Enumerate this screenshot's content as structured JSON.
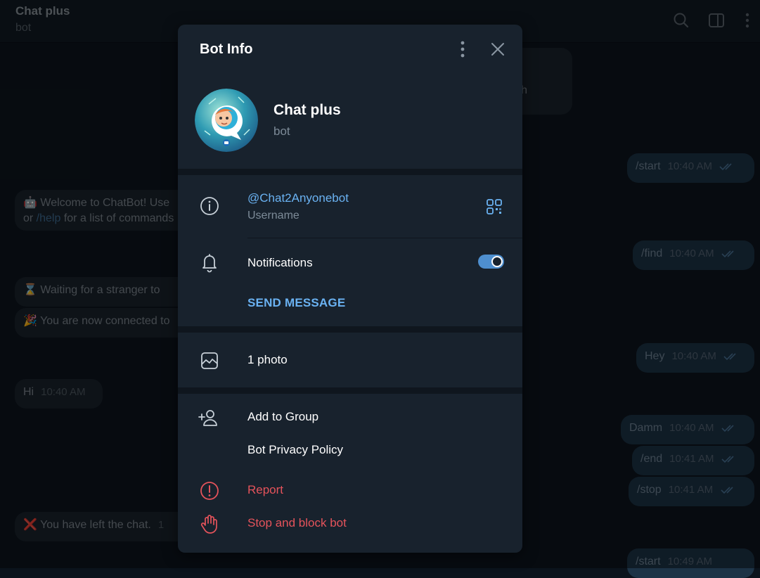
{
  "chat": {
    "title": "Chat plus",
    "subtitle": "bot",
    "messages": [
      {
        "text": "/start",
        "time": "10:40 AM"
      },
      {
        "text_prefix": "Welcome to ChatBot! Use",
        "text_line2_pre": "or ",
        "text_line2_link": "/help",
        "text_line2_post": " for a list of commands"
      },
      {
        "text": "/find",
        "time": "10:40 AM"
      },
      {
        "text": "Waiting for a stranger to"
      },
      {
        "text": "You are now connected to"
      },
      {
        "text": "Hey",
        "time": "10:40 AM"
      },
      {
        "text": "Hi",
        "time": "10:40 AM"
      },
      {
        "text": "Damm",
        "time": "10:40 AM"
      },
      {
        "text": "/end",
        "time": "10:41 AM"
      },
      {
        "text": "/stop",
        "time": "10:41 AM"
      },
      {
        "text": "You have left the chat.",
        "time": "1"
      },
      {
        "text": "/start",
        "time": "10:49 AM"
      }
    ],
    "partial_top_text": "h"
  },
  "modal": {
    "title": "Bot Info",
    "name": "Chat plus",
    "type": "bot",
    "username": "@Chat2Anyonebot",
    "username_label": "Username",
    "notifications_label": "Notifications",
    "notifications_on": true,
    "send_message": "SEND MESSAGE",
    "photos": "1 photo",
    "add_to_group": "Add to Group",
    "privacy_policy": "Bot Privacy Policy",
    "report": "Report",
    "stop_block": "Stop and block bot"
  },
  "colors": {
    "accent": "#6ab2f2",
    "danger": "#e5535b",
    "toggle": "#4e8fcf"
  },
  "icons": [
    "search-icon",
    "sidebar-toggle-icon",
    "more-vertical-icon",
    "close-icon",
    "info-icon",
    "qr-code-icon",
    "bell-icon",
    "image-icon",
    "add-user-icon",
    "report-icon",
    "hand-stop-icon"
  ]
}
